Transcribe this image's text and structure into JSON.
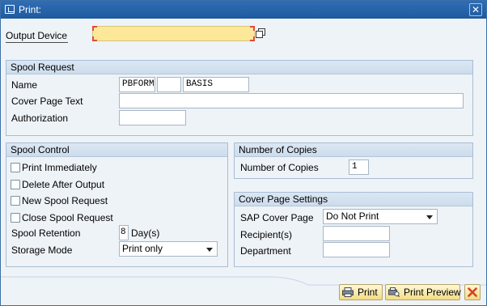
{
  "window": {
    "title": "Print:"
  },
  "output_device": {
    "label": "Output Device",
    "value": ""
  },
  "spool_request": {
    "header": "Spool Request",
    "name_label": "Name",
    "name_part1": "PBFORM",
    "name_part2": "",
    "name_part3": "BASIS",
    "cover_page_text_label": "Cover Page Text",
    "cover_page_text_value": "",
    "authorization_label": "Authorization",
    "authorization_value": ""
  },
  "spool_control": {
    "header": "Spool Control",
    "checkboxes": [
      {
        "label": "Print Immediately",
        "checked": false
      },
      {
        "label": "Delete After Output",
        "checked": false
      },
      {
        "label": "New Spool Request",
        "checked": false
      },
      {
        "label": "Close Spool Request",
        "checked": false
      }
    ],
    "retention_label": "Spool Retention",
    "retention_value": "8",
    "retention_unit": "Day(s)",
    "storage_mode_label": "Storage Mode",
    "storage_mode_value": "Print only"
  },
  "copies": {
    "header": "Number of Copies",
    "label": "Number of Copies",
    "value": "1"
  },
  "cover_page_settings": {
    "header": "Cover Page Settings",
    "sap_cover_page_label": "SAP Cover Page",
    "sap_cover_page_value": "Do Not Print",
    "recipients_label": "Recipient(s)",
    "recipients_value": "",
    "department_label": "Department",
    "department_value": ""
  },
  "footer": {
    "print_label": "Print",
    "print_preview_label": "Print Preview"
  },
  "colors": {
    "title_bar": "#1f5a9e",
    "window_bg": "#eef3f8",
    "required_field": "#fde89a",
    "button_bg": "#f3dc86",
    "cancel_icon": "#d9534f"
  }
}
